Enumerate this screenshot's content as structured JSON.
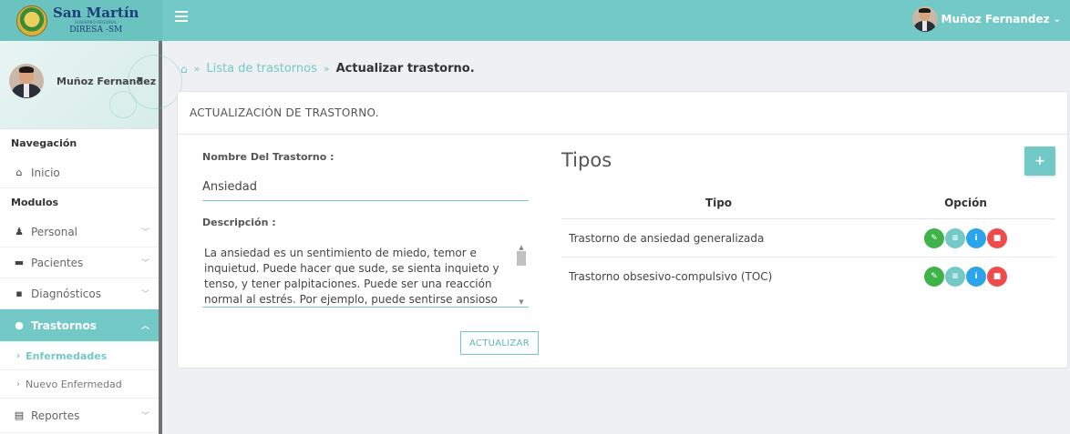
{
  "topbar": {
    "logo_title": "San Martín",
    "logo_subtitle": "GOBIERNO REGIONAL",
    "logo_org": "DIRESA -SM",
    "user_name": "Muñoz Fernandez",
    "user_caret": "⌄",
    "menu_icon": "hamburger-icon"
  },
  "sidebar": {
    "profile_name": "Muñoz Fernandez",
    "profile_caret": "▼",
    "section_nav": "Navegación",
    "section_modules": "Modulos",
    "items": [
      {
        "label": "Inicio",
        "icon": "home-icon",
        "glyph": "⌂"
      },
      {
        "label": "Personal",
        "icon": "user-icon",
        "glyph": "♟"
      },
      {
        "label": "Pacientes",
        "icon": "bed-icon",
        "glyph": "▬"
      },
      {
        "label": "Diagnósticos",
        "icon": "briefcase-icon",
        "glyph": "▪"
      },
      {
        "label": "Trastornos",
        "icon": "brain-icon",
        "glyph": "●"
      },
      {
        "label": "Reportes",
        "icon": "print-icon",
        "glyph": "▤"
      }
    ],
    "sub_items": [
      {
        "label": "Enfermedades"
      },
      {
        "label": "Nuevo Enfermedad"
      }
    ]
  },
  "breadcrumb": {
    "home_icon": "home-icon",
    "sep": "»",
    "item1": "Lista de trastornos",
    "current": "Actualizar trastorno."
  },
  "card": {
    "title": "ACTUALIZACIÓN DE TRASTORNO.",
    "name_label": "Nombre Del Trastorno :",
    "name_value": "Ansiedad",
    "desc_label": "Descripción :",
    "desc_value": "La ansiedad es un sentimiento de miedo, temor e inquietud. Puede hacer que sude, se sienta inquieto y tenso, y tener palpitaciones. Puede ser una reacción normal al estrés. Por ejemplo, puede sentirse ansioso cuando se enfrenta a un",
    "update_button": "ACTUALIZAR"
  },
  "tipos": {
    "title": "Tipos",
    "add_button": "+",
    "columns": [
      "Tipo",
      "Opción"
    ],
    "rows": [
      {
        "tipo": "Trastorno de ansiedad generalizada"
      },
      {
        "tipo": "Trastorno obsesivo-compulsivo (TOC)"
      }
    ],
    "action_glyphs": {
      "edit": "✎",
      "list": "≡",
      "info": "i",
      "delete": "■"
    }
  },
  "colors": {
    "accent": "#72c9c5",
    "edit": "#3fb24a",
    "info": "#2ba4ea",
    "delete": "#ef4b4b"
  }
}
